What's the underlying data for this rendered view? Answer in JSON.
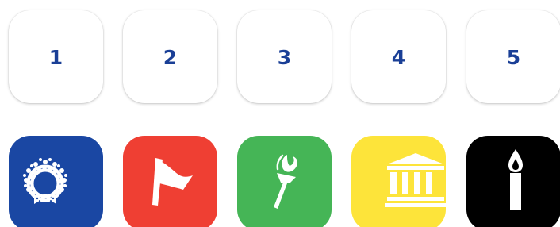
{
  "number_tiles": [
    "1",
    "2",
    "3",
    "4",
    "5"
  ],
  "icon_tiles": [
    {
      "icon": "wreath-icon",
      "color": "#1a47a3"
    },
    {
      "icon": "flag-icon",
      "color": "#ef3f33"
    },
    {
      "icon": "torch-icon",
      "color": "#45b556"
    },
    {
      "icon": "museum-icon",
      "color": "#fde43a"
    },
    {
      "icon": "candle-icon",
      "color": "#000000"
    }
  ],
  "colors": {
    "number_text": "#1a3f96",
    "number_tile_bg": "#ffffff"
  }
}
